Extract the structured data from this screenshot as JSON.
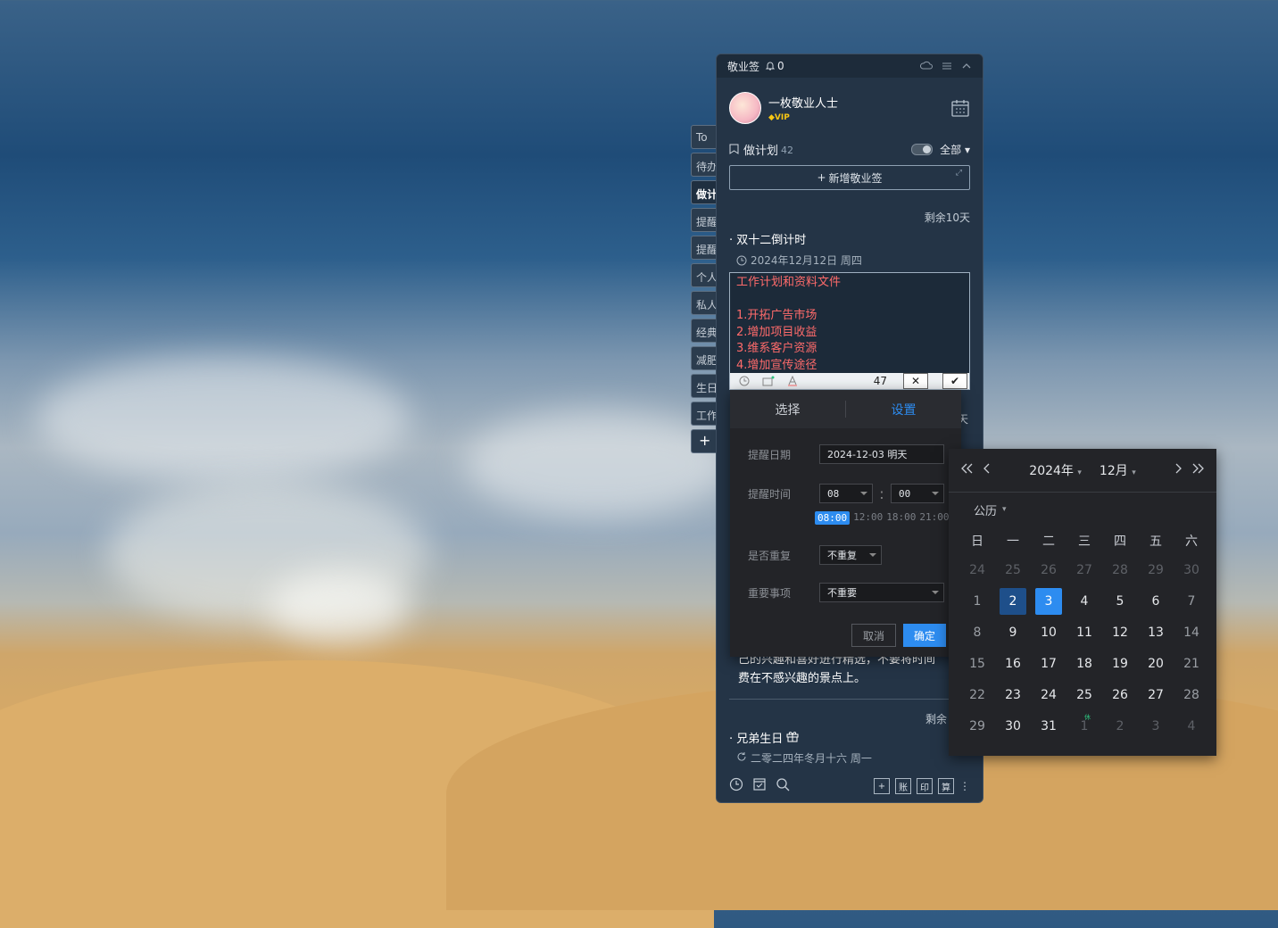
{
  "sidebar_tabs": [
    "To",
    "待办",
    "做计",
    "提醒",
    "提醒",
    "个人",
    "私人",
    "经典",
    "减肥",
    "生日",
    "工作"
  ],
  "sidebar_add": "+",
  "titlebar": {
    "app_name": "敬业签",
    "bell_count": "0"
  },
  "profile": {
    "name": "一枚敬业人士",
    "badge": "VIP"
  },
  "plan": {
    "label": "做计划",
    "count": "42",
    "filter": "全部"
  },
  "add_button": "新增敬业签",
  "note1": {
    "remain": "剩余10天",
    "title": "双十二倒计时",
    "date": "2024年12月12日 周四"
  },
  "editor": {
    "lines": [
      "工作计划和资料文件",
      "",
      "1.开拓广告市场",
      "2.增加项目收益",
      "3.维系客户资源",
      "4.增加宣传途径"
    ],
    "char_count": "47"
  },
  "behind_text": {
    "line1": "己的兴趣和喜好进行精选，不要将时间",
    "line2": "费在不感兴趣的景点上。",
    "partial_day": "天"
  },
  "note3": {
    "remain": "剩余",
    "title": "兄弟生日",
    "lunar": "二零二四年冬月十六 周一"
  },
  "bottom_bar": {
    "btn1": "账",
    "btn2": "印",
    "btn3": "算"
  },
  "dialog": {
    "tab_select": "选择",
    "tab_settings": "设置",
    "date_label": "提醒日期",
    "date_value": "2024-12-03 明天",
    "time_label": "提醒时间",
    "hour": "08",
    "minute": "00",
    "colon": ":",
    "quick_times": [
      "08:00",
      "12:00",
      "18:00",
      "21:00"
    ],
    "repeat_label": "是否重复",
    "repeat_value": "不重复",
    "important_label": "重要事项",
    "important_value": "不重要",
    "cancel": "取消",
    "confirm": "确定"
  },
  "calendar": {
    "year": "2024年",
    "month": "12月",
    "mode": "公历",
    "weekdays": [
      "日",
      "一",
      "二",
      "三",
      "四",
      "五",
      "六"
    ],
    "days": [
      [
        "24",
        "25",
        "26",
        "27",
        "28",
        "29",
        "30"
      ],
      [
        "1",
        "2",
        "3",
        "4",
        "5",
        "6",
        "7"
      ],
      [
        "8",
        "9",
        "10",
        "11",
        "12",
        "13",
        "14"
      ],
      [
        "15",
        "16",
        "17",
        "18",
        "19",
        "20",
        "21"
      ],
      [
        "22",
        "23",
        "24",
        "25",
        "26",
        "27",
        "28"
      ],
      [
        "29",
        "30",
        "31",
        "1",
        "2",
        "3",
        "4"
      ]
    ],
    "today": "2",
    "selected": "3",
    "holiday_mark": "休"
  }
}
